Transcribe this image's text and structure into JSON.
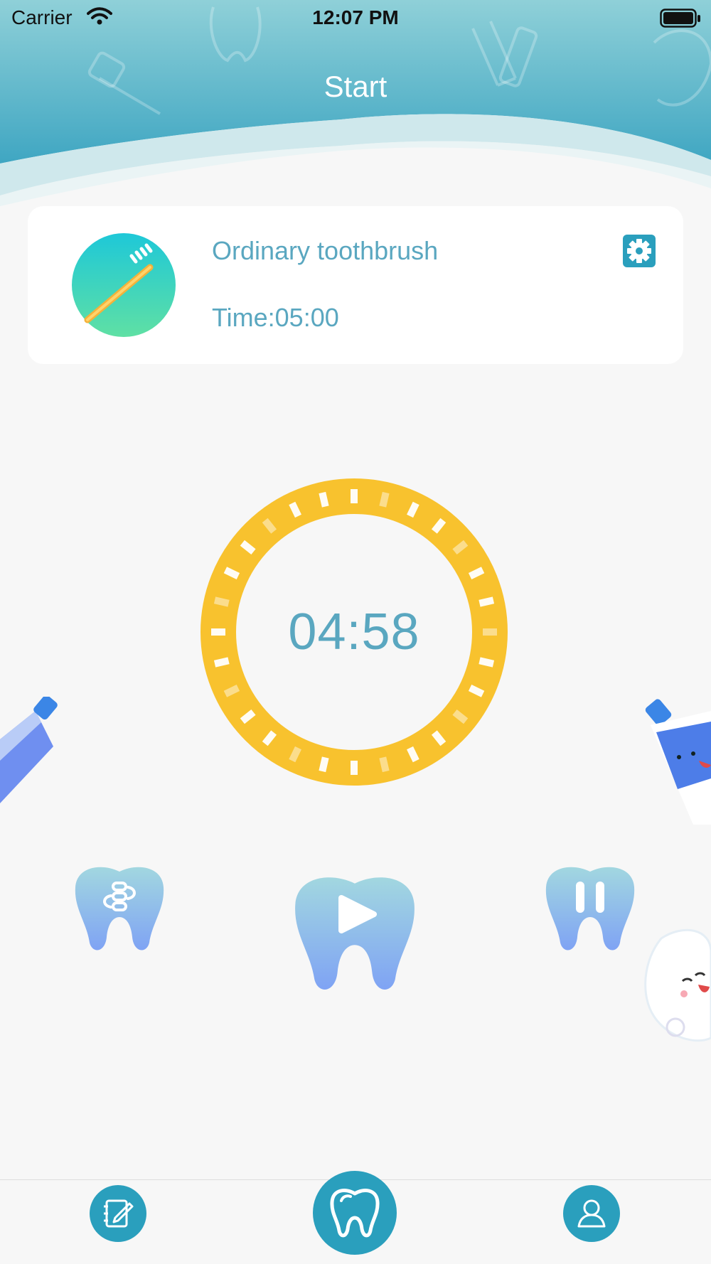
{
  "status_bar": {
    "carrier": "Carrier",
    "time": "12:07 PM"
  },
  "nav": {
    "title": "Start"
  },
  "brush_card": {
    "name": "Ordinary toothbrush",
    "time_label": "Time:05:00",
    "avatar_icon": "toothbrush-icon",
    "settings_icon": "gear-icon"
  },
  "timer": {
    "remaining": "04:58",
    "ring_color": "#f8c22e",
    "text_color": "#5aa7c0"
  },
  "controls": [
    {
      "name": "mode-switch",
      "icon": "swap-icon"
    },
    {
      "name": "play",
      "icon": "play-icon"
    },
    {
      "name": "pause",
      "icon": "pause-icon"
    }
  ],
  "tabbar": {
    "items": [
      {
        "name": "records",
        "icon": "note-edit-icon"
      },
      {
        "name": "brush",
        "icon": "tooth-icon",
        "selected": true
      },
      {
        "name": "profile",
        "icon": "user-icon"
      }
    ]
  },
  "colors": {
    "accent": "#2a9fbd",
    "header_top": "#8fd0d8",
    "header_bottom": "#47a9c4",
    "background": "#f7f7f7",
    "tooth_top": "#a2d7e0",
    "tooth_bottom": "#7fa3f4"
  }
}
